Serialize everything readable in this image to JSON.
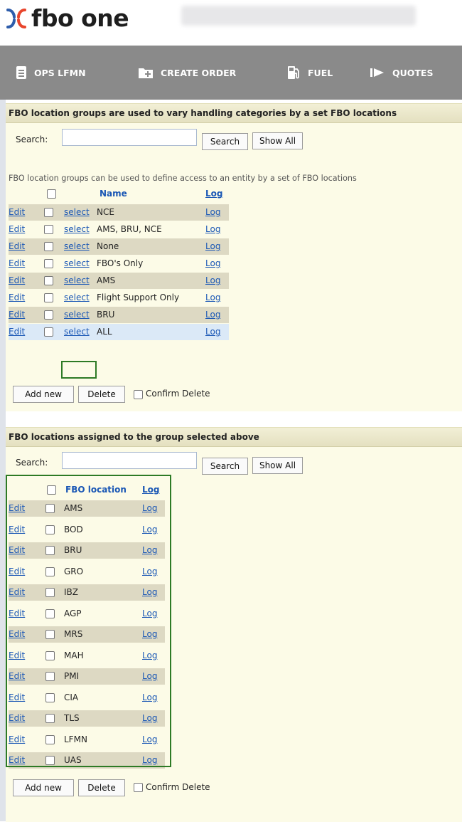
{
  "app": {
    "logo_text": "fbo one"
  },
  "nav": [
    {
      "label": "OPS LFMN",
      "icon": "document-icon"
    },
    {
      "label": "CREATE ORDER",
      "icon": "folder-plus-icon"
    },
    {
      "label": "FUEL",
      "icon": "fuel-pump-icon"
    },
    {
      "label": "QUOTES",
      "icon": "quotes-icon"
    }
  ],
  "groups": {
    "title": "FBO location groups are used to vary handling categories by a set FBO locations",
    "search_label": "Search:",
    "search_value": "",
    "search_button": "Search",
    "show_all_button": "Show All",
    "hint": "FBO location groups can be used to define access to an entity by a set of FBO locations",
    "col_name": "Name",
    "col_log": "Log",
    "edit_text": "Edit",
    "select_text": "select",
    "log_text": "Log",
    "rows": [
      "NCE",
      "AMS, BRU, NCE",
      "None",
      "FBO's Only",
      "AMS",
      "Flight Support Only",
      "BRU",
      "ALL"
    ],
    "add_new": "Add new",
    "delete": "Delete",
    "confirm_delete": "Confirm Delete"
  },
  "locations": {
    "title": "FBO locations assigned to the group selected above",
    "search_label": "Search:",
    "search_value": "",
    "search_button": "Search",
    "show_all_button": "Show All",
    "col_location": "FBO location",
    "col_log": "Log",
    "edit_text": "Edit",
    "log_text": "Log",
    "rows": [
      "AMS",
      "BOD",
      "BRU",
      "GRO",
      "IBZ",
      "AGP",
      "MRS",
      "MAH",
      "PMI",
      "CIA",
      "TLS",
      "LFMN",
      "UAS"
    ],
    "add_new": "Add new",
    "delete": "Delete",
    "confirm_delete": "Confirm Delete"
  },
  "colors": {
    "nav_bg": "#8a8a8a",
    "panel_bg": "#fcfbe7",
    "row_alt": "#ddd9c3",
    "row_selected": "#dbe9f7",
    "link": "#1a57b5",
    "highlight_box": "#2d7a25",
    "logo_red": "#e8452c",
    "logo_blue": "#2e5dab"
  }
}
